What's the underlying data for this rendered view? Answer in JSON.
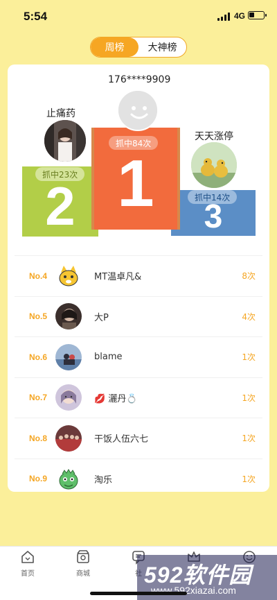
{
  "status_bar": {
    "time": "5:54",
    "network": "4G"
  },
  "tabs": [
    {
      "label": "周榜",
      "active": true
    },
    {
      "label": "大神榜",
      "active": false
    }
  ],
  "podium": {
    "first": {
      "name": "176****9909",
      "count": "抓中84次",
      "rank": "1"
    },
    "second": {
      "name": "止痛药",
      "count": "抓中23次",
      "rank": "2"
    },
    "third": {
      "name": "天天涨停",
      "count": "抓中14次",
      "rank": "3"
    }
  },
  "ranking": [
    {
      "no": "No.4",
      "name": "MT温卓凡&",
      "count": "8次",
      "avatar_icon": "cartoon-cat-avatar"
    },
    {
      "no": "No.5",
      "name": "大P",
      "count": "4次",
      "avatar_icon": "photo-avatar"
    },
    {
      "no": "No.6",
      "name": "blame",
      "count": "1次",
      "avatar_icon": "photo-avatar"
    },
    {
      "no": "No.7",
      "name": "💋 灑丹💍",
      "count": "1次",
      "avatar_icon": "photo-avatar"
    },
    {
      "no": "No.8",
      "name": "干饭人伍六七",
      "count": "1次",
      "avatar_icon": "photo-avatar"
    },
    {
      "no": "No.9",
      "name": "淘乐",
      "count": "1次",
      "avatar_icon": "cartoon-dino-avatar"
    }
  ],
  "bottom_nav": [
    {
      "label": "首页",
      "icon": "home-icon"
    },
    {
      "label": "商城",
      "icon": "shop-icon"
    },
    {
      "label": "社",
      "icon": "chat-icon"
    },
    {
      "label": "",
      "icon": "crown-icon"
    },
    {
      "label": "",
      "icon": "smile-icon"
    }
  ],
  "watermark": {
    "brand": "592软件园",
    "url": "www.592xiazai.com"
  },
  "colors": {
    "background": "#fbef9a",
    "accent": "#f6a623",
    "first_block": "#f26b3d",
    "second_block": "#b2ce48",
    "third_block": "#5b8ec6"
  }
}
